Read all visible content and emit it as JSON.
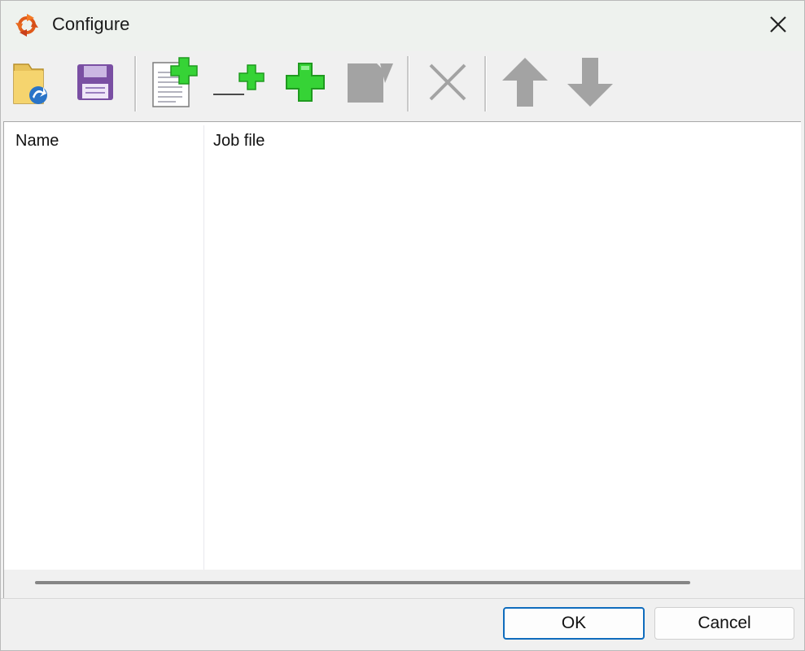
{
  "window": {
    "title": "Configure",
    "app_icon": "refresh-arrows-icon",
    "close_icon": "close-icon"
  },
  "toolbar": {
    "buttons": [
      {
        "name": "open-folder-button",
        "icon": "folder-open-icon",
        "enabled": true
      },
      {
        "name": "save-button",
        "icon": "floppy-disk-icon",
        "enabled": true
      },
      {
        "name": "add-job-file-button",
        "icon": "document-add-icon",
        "enabled": true
      },
      {
        "name": "add-separator-button",
        "icon": "line-add-icon",
        "enabled": true
      },
      {
        "name": "add-button",
        "icon": "green-plus-icon",
        "enabled": true
      },
      {
        "name": "edit-button",
        "icon": "edit-icon",
        "enabled": false
      },
      {
        "name": "delete-button",
        "icon": "delete-x-icon",
        "enabled": false
      },
      {
        "name": "move-up-button",
        "icon": "arrow-up-icon",
        "enabled": false
      },
      {
        "name": "move-down-button",
        "icon": "arrow-down-icon",
        "enabled": false
      }
    ]
  },
  "list": {
    "columns": [
      "Name",
      "Job file"
    ],
    "rows": []
  },
  "footer": {
    "ok_label": "OK",
    "cancel_label": "Cancel"
  },
  "colors": {
    "accent": "#0f6cbd",
    "plus_green": "#2ecc2e",
    "disabled_gray": "#a3a3a3",
    "floppy_purple": "#7a4fa3"
  }
}
